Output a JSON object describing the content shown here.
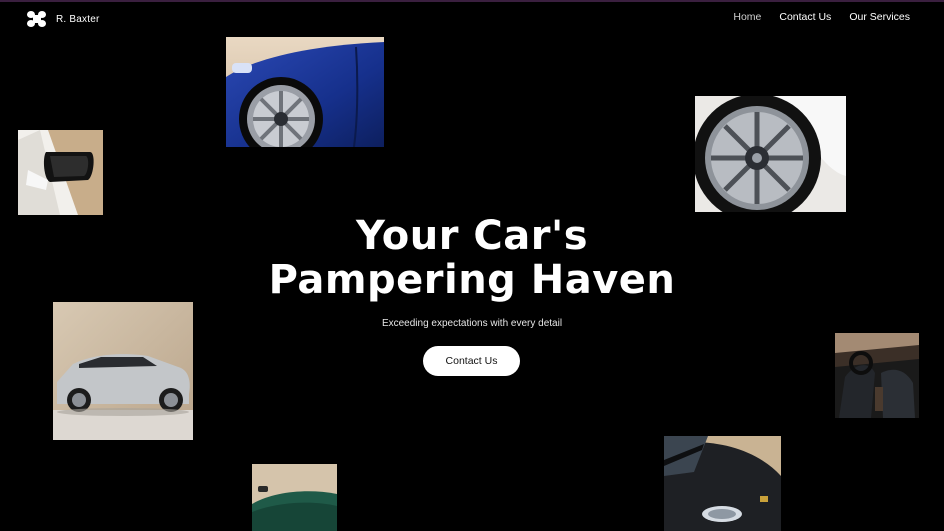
{
  "header": {
    "brand": "R. Baxter",
    "nav": [
      {
        "label": "Home",
        "active": true
      },
      {
        "label": "Contact Us",
        "active": false
      },
      {
        "label": "Our Services",
        "active": false
      }
    ]
  },
  "hero": {
    "title_line1": "Your Car's",
    "title_line2": "Pampering Haven",
    "subtitle": "Exceeding expectations with every detail",
    "cta_label": "Contact Us"
  },
  "colors": {
    "background": "#000000",
    "text": "#ffffff",
    "button_bg": "#ffffff",
    "button_text": "#111111",
    "accent_top_line": "#3a1f3f"
  },
  "photos": [
    {
      "name": "blue-car-wheel-photo"
    },
    {
      "name": "white-car-mirror-photo"
    },
    {
      "name": "alloy-wheel-photo"
    },
    {
      "name": "silver-suv-photo"
    },
    {
      "name": "car-interior-photo"
    },
    {
      "name": "green-car-photo"
    },
    {
      "name": "black-sports-car-photo"
    }
  ]
}
